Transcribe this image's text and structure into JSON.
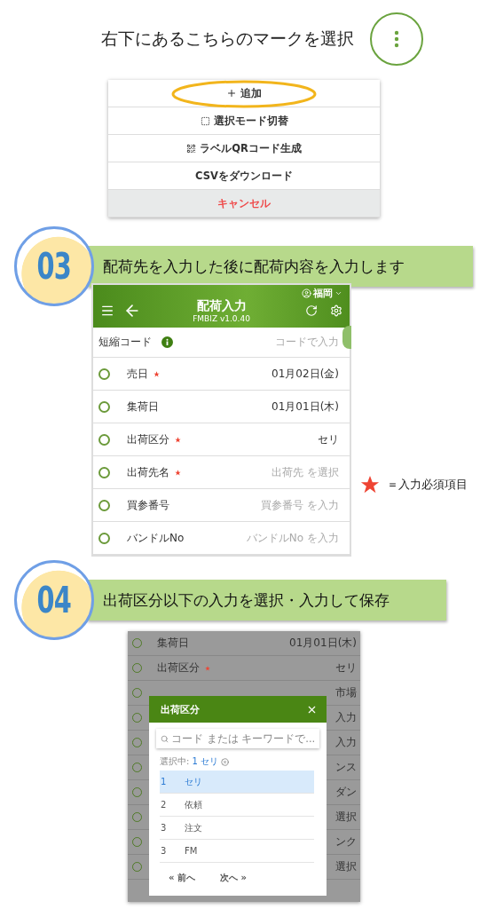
{
  "intro": {
    "text": "右下にあるこちらのマークを選択",
    "menu": [
      {
        "label": "追加",
        "kind": "add",
        "highlighted": true
      },
      {
        "label": "選択モード切替",
        "kind": "select",
        "highlighted": false
      },
      {
        "label": "ラベルQRコード生成",
        "kind": "qr",
        "highlighted": false
      },
      {
        "label": "CSVをダウンロード",
        "kind": "plain",
        "highlighted": false
      },
      {
        "label": "キャンセル",
        "kind": "cancel",
        "highlighted": false
      }
    ]
  },
  "step3": {
    "number": "03",
    "text": "配荷先を入力した後に配荷内容を入力します",
    "app": {
      "user": "福岡",
      "title": "配荷入力",
      "subtitle": "FMBIZ v1.0.40",
      "shortcode": {
        "label": "短縮コード",
        "placeholder": "コードで入力"
      },
      "fields": [
        {
          "label": "売日",
          "required": true,
          "checked": false,
          "value": "01月02日(金)"
        },
        {
          "label": "集荷日",
          "required": false,
          "checked": false,
          "value": "01月01日(木)"
        },
        {
          "label": "出荷区分",
          "required": true,
          "checked": false,
          "value": "セリ"
        },
        {
          "label": "出荷先名",
          "required": true,
          "checked": false,
          "placeholder": "出荷先 を選択"
        },
        {
          "label": "買参番号",
          "required": false,
          "checked": false,
          "placeholder": "買参番号 を入力"
        },
        {
          "label": "バンドルNo",
          "required": false,
          "checked": false,
          "placeholder": "バンドルNo を入力"
        }
      ]
    },
    "legend": "＝入力必須項目"
  },
  "step4": {
    "number": "04",
    "text": "出荷区分以下の入力を選択・入力して保存",
    "rows": [
      {
        "label": "集荷日",
        "required": false,
        "checked": false,
        "value": "01月01日(木)"
      },
      {
        "label": "出荷区分",
        "required": true,
        "checked": false,
        "value": "セリ"
      },
      {
        "checked": false,
        "value": "市場"
      },
      {
        "checked": false,
        "value": "入力"
      },
      {
        "checked": false,
        "value": "入力"
      },
      {
        "checked": false,
        "value": "ンス"
      },
      {
        "checked": false,
        "value": "ダン"
      },
      {
        "checked": false,
        "value": "選択"
      },
      {
        "checked": false,
        "value": "ンク"
      },
      {
        "checked": false,
        "value": "選択"
      }
    ],
    "dialog": {
      "title": "出荷区分",
      "search_placeholder": "コード または キーワードで...",
      "selected_label": "選択中:",
      "selected_value": "1 セリ",
      "options": [
        {
          "code": "1",
          "name": "セリ",
          "selected": true
        },
        {
          "code": "2",
          "name": "依頼",
          "selected": false
        },
        {
          "code": "3",
          "name": "注文",
          "selected": false
        },
        {
          "code": "3",
          "name": "FM",
          "selected": false
        }
      ],
      "prev": "« 前へ",
      "next": "次へ »"
    }
  }
}
